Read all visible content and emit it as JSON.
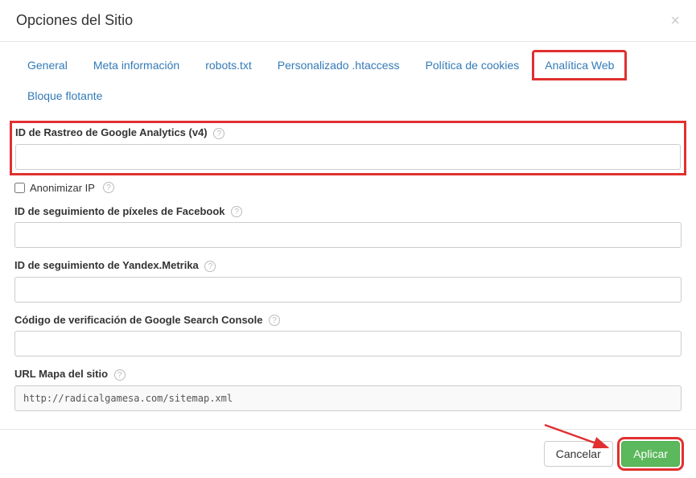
{
  "header": {
    "title": "Opciones del Sitio"
  },
  "tabs": {
    "general": "General",
    "meta": "Meta información",
    "robots": "robots.txt",
    "htaccess": "Personalizado .htaccess",
    "cookies": "Política de cookies",
    "analytics": "Analítica Web",
    "floating": "Bloque flotante"
  },
  "fields": {
    "ga_id": {
      "label": "ID de Rastreo de Google Analytics (v4)",
      "value": ""
    },
    "anonymize": {
      "label": "Anonimizar IP",
      "checked": false
    },
    "fb_pixel": {
      "label": "ID de seguimiento de píxeles de Facebook",
      "value": ""
    },
    "yandex": {
      "label": "ID de seguimiento de Yandex.Metrika",
      "value": ""
    },
    "gsc": {
      "label": "Código de verificación de Google Search Console",
      "value": ""
    },
    "sitemap": {
      "label": "URL Mapa del sitio",
      "value": "http://radicalgamesa.com/sitemap.xml"
    }
  },
  "footer": {
    "cancel": "Cancelar",
    "apply": "Aplicar"
  }
}
